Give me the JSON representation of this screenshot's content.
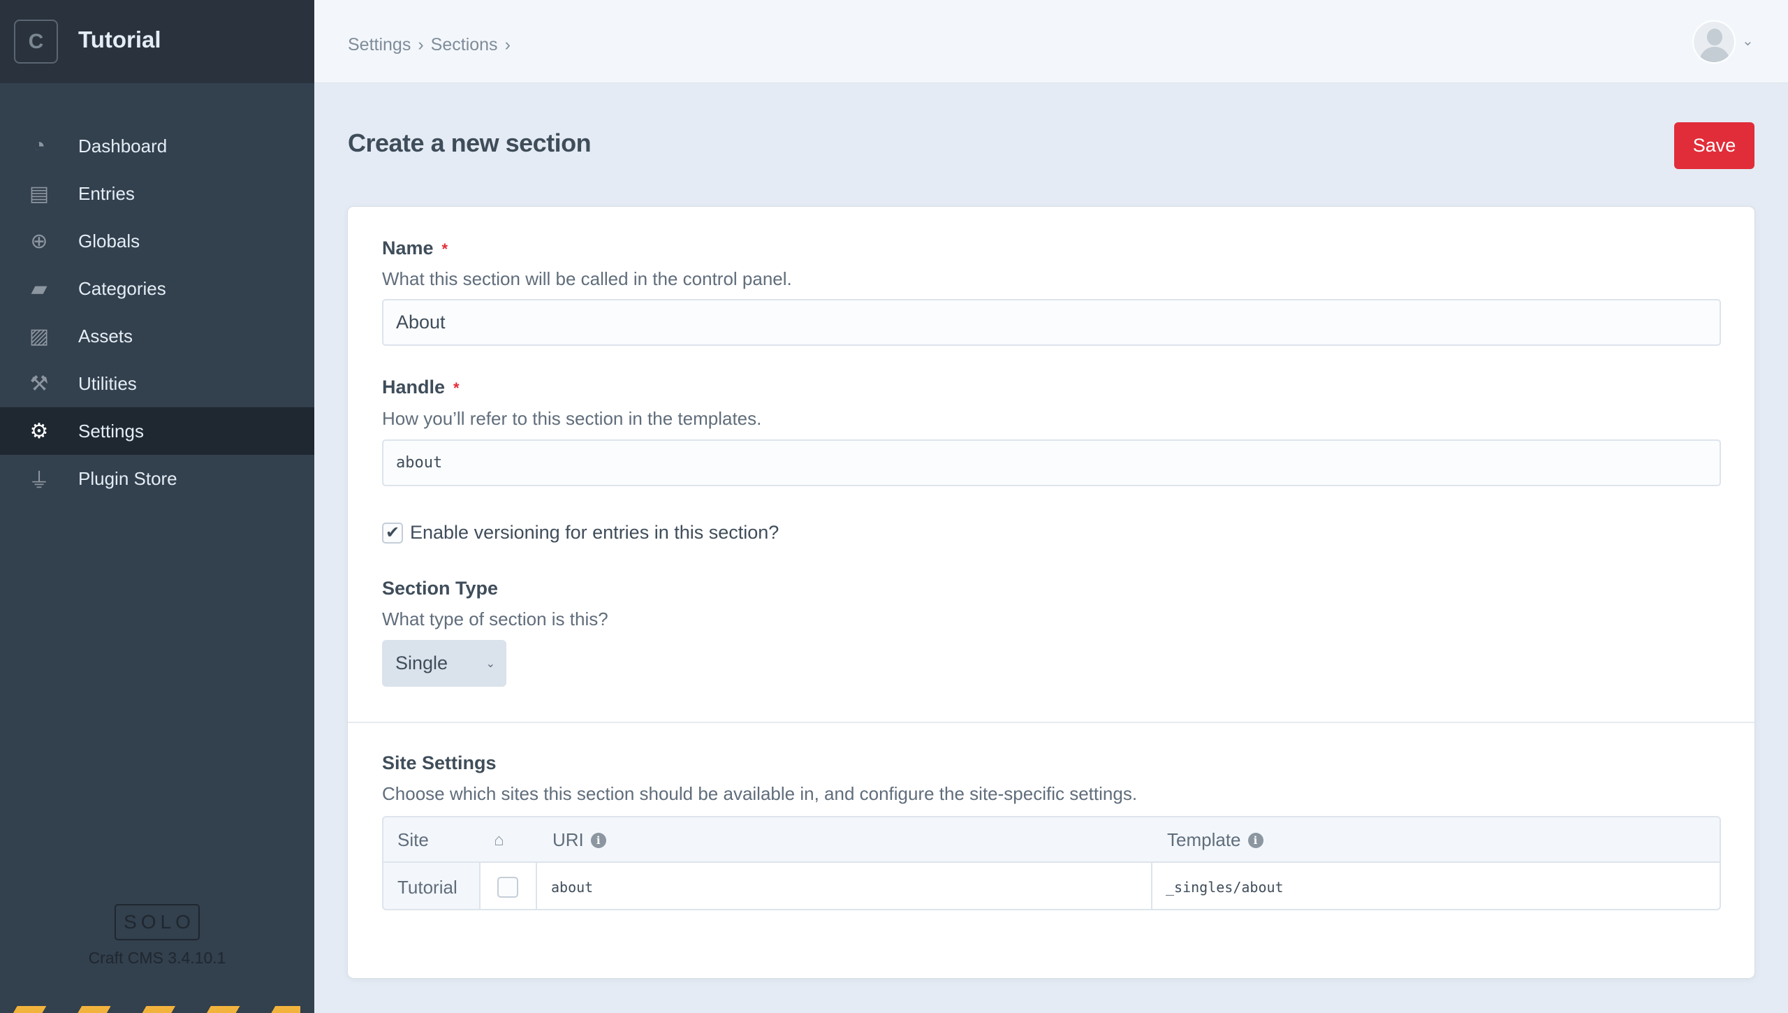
{
  "sidebar": {
    "logo_letter": "C",
    "site_name": "Tutorial",
    "items": [
      {
        "label": "Dashboard",
        "icon": "gauge-icon"
      },
      {
        "label": "Entries",
        "icon": "newspaper-icon"
      },
      {
        "label": "Globals",
        "icon": "globe-icon"
      },
      {
        "label": "Categories",
        "icon": "folder-open-icon"
      },
      {
        "label": "Assets",
        "icon": "image-icon"
      },
      {
        "label": "Utilities",
        "icon": "wrench-icon"
      },
      {
        "label": "Settings",
        "icon": "gear-icon",
        "active": true
      },
      {
        "label": "Plugin Store",
        "icon": "plug-icon"
      }
    ],
    "edition": "SOLO",
    "version": "Craft CMS 3.4.10.1"
  },
  "breadcrumb": [
    "Settings",
    "Sections"
  ],
  "breadcrumb_sep": "›",
  "page": {
    "title": "Create a new section",
    "save_label": "Save",
    "accent": "#e12d39"
  },
  "form": {
    "name": {
      "label": "Name",
      "instructions": "What this section will be called in the control panel.",
      "value": "About"
    },
    "handle": {
      "label": "Handle",
      "instructions": "How you’ll refer to this section in the templates.",
      "value": "about"
    },
    "versioning": {
      "label": "Enable versioning for entries in this section?",
      "checked": true
    },
    "section_type": {
      "label": "Section Type",
      "instructions": "What type of section is this?",
      "value": "Single"
    },
    "site_settings": {
      "label": "Site Settings",
      "instructions": "Choose which sites this section should be available in, and configure the site-specific settings.",
      "columns": {
        "site": "Site",
        "uri": "URI",
        "template": "Template"
      },
      "rows": [
        {
          "site": "Tutorial",
          "homepage": false,
          "uri": "about",
          "template": "_singles/about"
        }
      ]
    },
    "required_mark": "*"
  }
}
